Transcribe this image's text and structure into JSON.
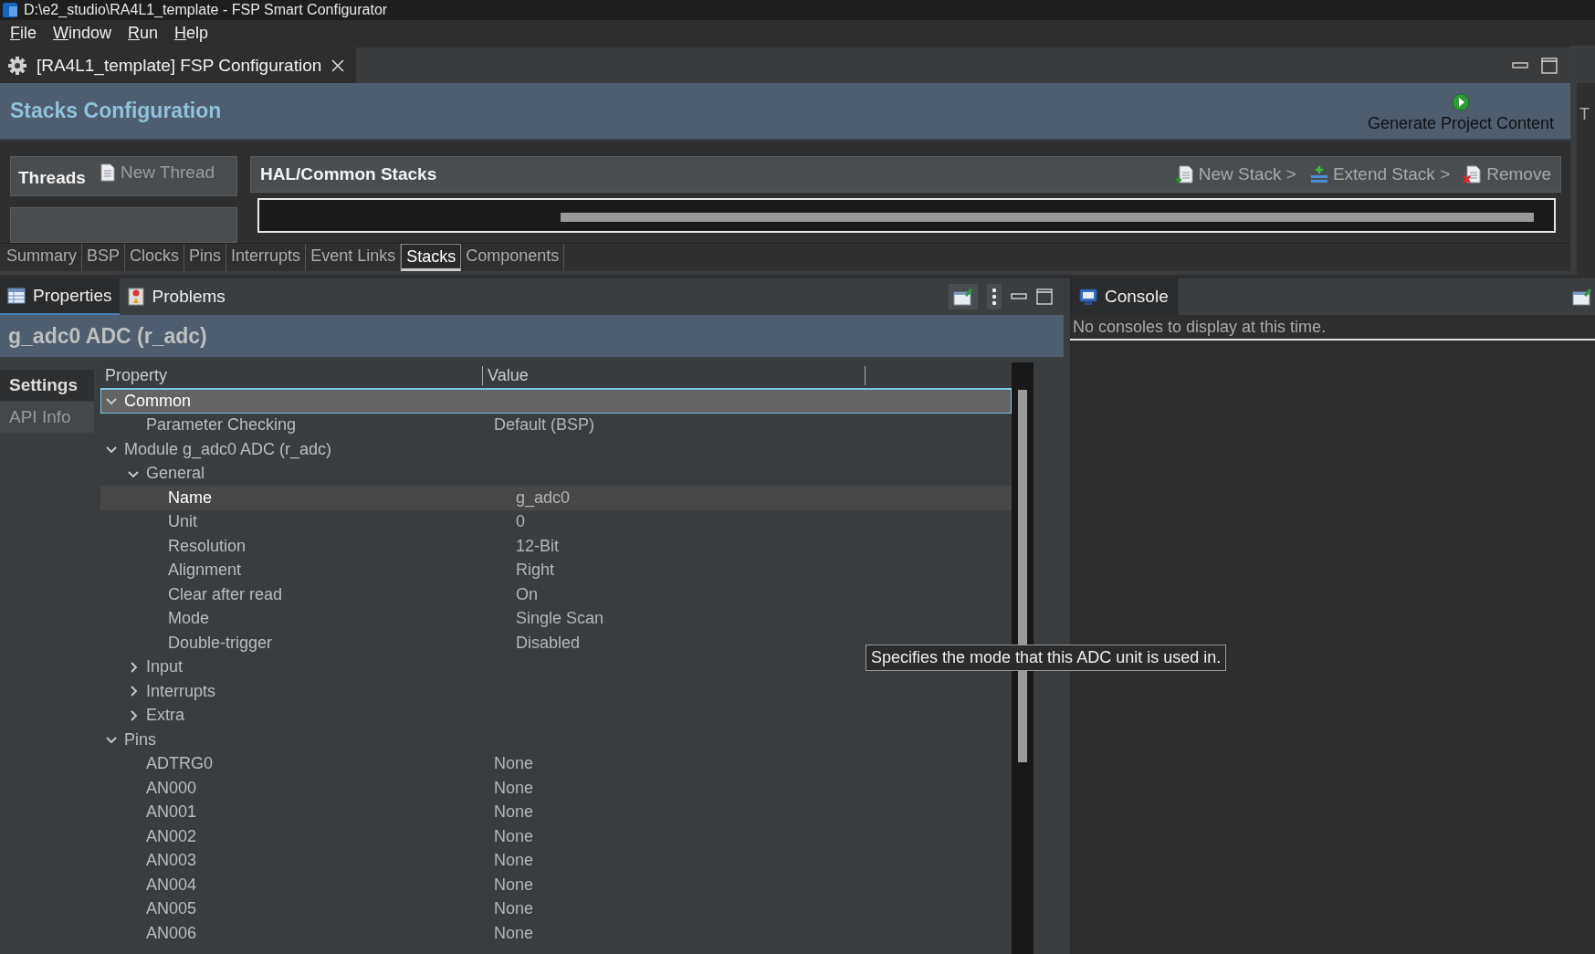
{
  "window": {
    "title": "D:\\e2_studio\\RA4L1_template - FSP Smart Configurator"
  },
  "menu": [
    {
      "label": "File"
    },
    {
      "label": "Window"
    },
    {
      "label": "Run"
    },
    {
      "label": "Help"
    }
  ],
  "editor_tab": {
    "title": "[RA4L1_template] FSP Configuration",
    "selected": true
  },
  "header": {
    "title": "Stacks Configuration",
    "generate_button": "Generate Project Content"
  },
  "side_strip": {
    "label": "T"
  },
  "threads": {
    "title": "Threads",
    "new_thread": "New Thread"
  },
  "stacks_panel": {
    "title": "HAL/Common Stacks",
    "actions": [
      {
        "label": "New Stack >",
        "kind": "new"
      },
      {
        "label": "Extend Stack >",
        "kind": "extend"
      },
      {
        "label": "Remove",
        "kind": "remove"
      }
    ]
  },
  "config_tabs": [
    {
      "label": "Summary",
      "selected": false
    },
    {
      "label": "BSP",
      "selected": false
    },
    {
      "label": "Clocks",
      "selected": false
    },
    {
      "label": "Pins",
      "selected": false
    },
    {
      "label": "Interrupts",
      "selected": false
    },
    {
      "label": "Event Links",
      "selected": false
    },
    {
      "label": "Stacks",
      "selected": true
    },
    {
      "label": "Components",
      "selected": false
    }
  ],
  "views": [
    {
      "label": "Properties",
      "kind": "properties",
      "selected": true
    },
    {
      "label": "Problems",
      "kind": "problems",
      "selected": false
    }
  ],
  "properties": {
    "title": "g_adc0 ADC (r_adc)",
    "side_tabs": [
      {
        "label": "Settings",
        "selected": true
      },
      {
        "label": "API Info",
        "selected": false
      }
    ],
    "columns": [
      "Property",
      "Value"
    ],
    "rows": [
      {
        "label": "Common",
        "expanded": true,
        "selected": true,
        "hovered": false,
        "children": [
          {
            "label": "Parameter Checking",
            "value": "Default (BSP)",
            "selected": false,
            "hovered": false
          }
        ]
      },
      {
        "label": "Module g_adc0 ADC (r_adc)",
        "expanded": true,
        "selected": false,
        "hovered": false,
        "children": [
          {
            "label": "General",
            "expanded": true,
            "selected": false,
            "hovered": false,
            "children": [
              {
                "label": "Name",
                "value": "g_adc0",
                "selected": false,
                "hovered": true
              },
              {
                "label": "Unit",
                "value": "0",
                "selected": false,
                "hovered": false
              },
              {
                "label": "Resolution",
                "value": "12-Bit",
                "selected": false,
                "hovered": false
              },
              {
                "label": "Alignment",
                "value": "Right",
                "selected": false,
                "hovered": false
              },
              {
                "label": "Clear after read",
                "value": "On",
                "selected": false,
                "hovered": false
              },
              {
                "label": "Mode",
                "value": "Single Scan",
                "selected": false,
                "hovered": false
              },
              {
                "label": "Double-trigger",
                "value": "Disabled",
                "selected": false,
                "hovered": false
              }
            ]
          },
          {
            "label": "Input",
            "expanded": false,
            "selected": false,
            "hovered": false
          },
          {
            "label": "Interrupts",
            "expanded": false,
            "selected": false,
            "hovered": false
          },
          {
            "label": "Extra",
            "expanded": false,
            "selected": false,
            "hovered": false
          }
        ]
      },
      {
        "label": "Pins",
        "expanded": true,
        "selected": false,
        "hovered": false,
        "children": [
          {
            "label": "ADTRG0",
            "value": "None",
            "selected": false,
            "hovered": false
          },
          {
            "label": "AN000",
            "value": "None",
            "selected": false,
            "hovered": false
          },
          {
            "label": "AN001",
            "value": "None",
            "selected": false,
            "hovered": false
          },
          {
            "label": "AN002",
            "value": "None",
            "selected": false,
            "hovered": false
          },
          {
            "label": "AN003",
            "value": "None",
            "selected": false,
            "hovered": false
          },
          {
            "label": "AN004",
            "value": "None",
            "selected": false,
            "hovered": false
          },
          {
            "label": "AN005",
            "value": "None",
            "selected": false,
            "hovered": false
          },
          {
            "label": "AN006",
            "value": "None",
            "selected": false,
            "hovered": false
          }
        ]
      }
    ],
    "tooltip": "Specifies the mode that this ADC unit is used in."
  },
  "console": {
    "tab": "Console",
    "message": "No consoles to display at this time."
  }
}
